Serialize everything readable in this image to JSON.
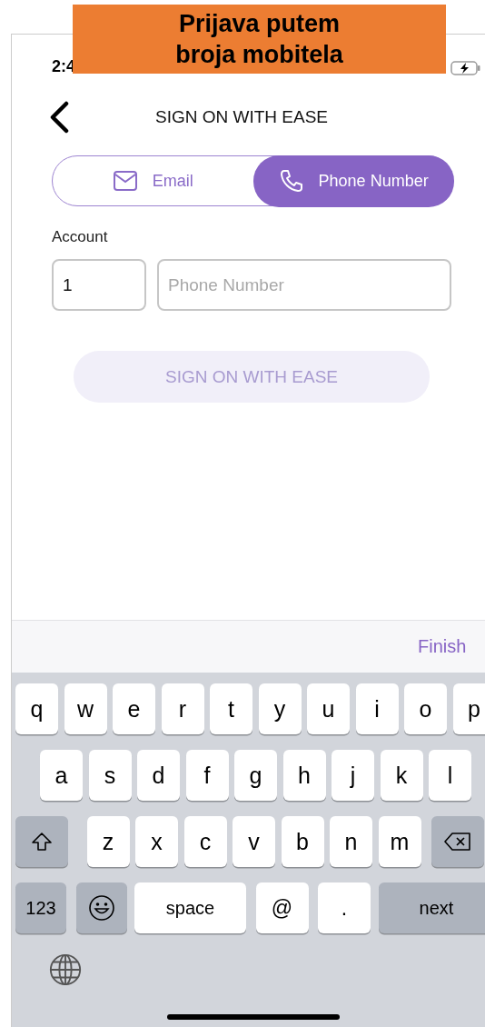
{
  "banner": {
    "lines": [
      "Prijava putem",
      "broja mobitela"
    ]
  },
  "status_bar": {
    "time": "2:4"
  },
  "header": {
    "title": "SIGN ON WITH EASE"
  },
  "tabs": [
    {
      "label": "Email",
      "kind": "email",
      "selected": false
    },
    {
      "label": "Phone Number",
      "kind": "phone",
      "selected": true
    }
  ],
  "account": {
    "label": "Account",
    "country_code": "1",
    "phone": {
      "placeholder": "Phone Number"
    }
  },
  "submit": {
    "label": "SIGN ON WITH EASE",
    "disabled": true
  },
  "keyboard": {
    "done": "Finish",
    "rows": [
      {
        "keys": [
          {
            "kind": "char",
            "label": "q"
          },
          {
            "kind": "char",
            "label": "w"
          },
          {
            "kind": "char",
            "label": "e"
          },
          {
            "kind": "char",
            "label": "r"
          },
          {
            "kind": "char",
            "label": "t"
          },
          {
            "kind": "char",
            "label": "y"
          },
          {
            "kind": "char",
            "label": "u"
          },
          {
            "kind": "char",
            "label": "i"
          },
          {
            "kind": "char",
            "label": "o"
          },
          {
            "kind": "char",
            "label": "p"
          }
        ]
      },
      {
        "keys": [
          {
            "kind": "char",
            "label": "a"
          },
          {
            "kind": "char",
            "label": "s"
          },
          {
            "kind": "char",
            "label": "d"
          },
          {
            "kind": "char",
            "label": "f"
          },
          {
            "kind": "char",
            "label": "g"
          },
          {
            "kind": "char",
            "label": "h"
          },
          {
            "kind": "char",
            "label": "j"
          },
          {
            "kind": "char",
            "label": "k"
          },
          {
            "kind": "char",
            "label": "l"
          }
        ]
      },
      {
        "keys": [
          {
            "kind": "shift"
          },
          {
            "kind": "char",
            "label": "z"
          },
          {
            "kind": "char",
            "label": "x"
          },
          {
            "kind": "char",
            "label": "c"
          },
          {
            "kind": "char",
            "label": "v"
          },
          {
            "kind": "char",
            "label": "b"
          },
          {
            "kind": "char",
            "label": "n"
          },
          {
            "kind": "char",
            "label": "m"
          },
          {
            "kind": "delete"
          }
        ]
      },
      {
        "keys": [
          {
            "kind": "numbers",
            "label": "123"
          },
          {
            "kind": "emoji"
          },
          {
            "kind": "space",
            "label": "space"
          },
          {
            "kind": "symbol",
            "label": "@"
          },
          {
            "kind": "symbol",
            "label": "."
          },
          {
            "kind": "return",
            "label": "next"
          }
        ]
      }
    ]
  }
}
